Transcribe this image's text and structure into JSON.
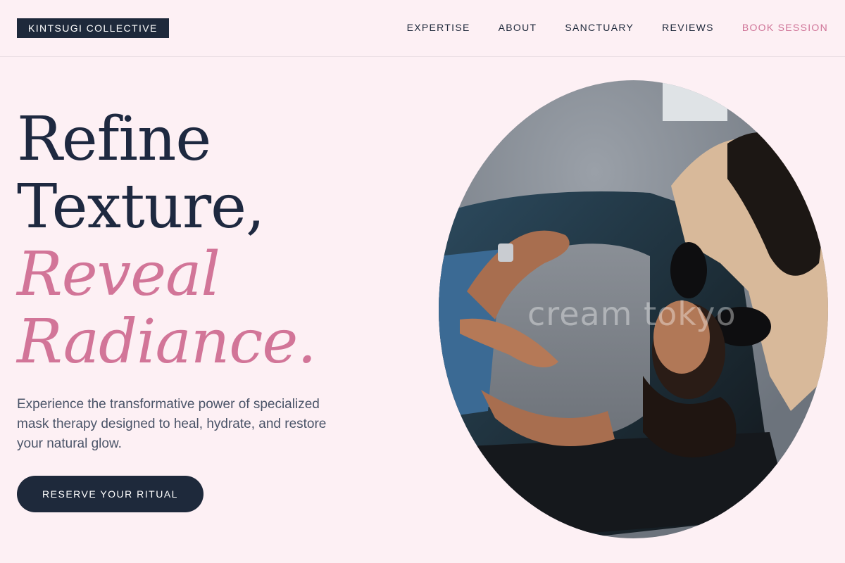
{
  "brand": {
    "name": "KINTSUGI COLLECTIVE"
  },
  "nav": {
    "items": [
      "EXPERTISE",
      "ABOUT",
      "SANCTUARY",
      "REVIEWS"
    ],
    "cta": "BOOK SESSION"
  },
  "hero": {
    "headline_line1": "Refine",
    "headline_line2": "Texture,",
    "headline_line3": "Reveal",
    "headline_line4": "Radiance.",
    "description": "Experience the transformative power of specialized mask therapy designed to heal, hydrate, and restore your natural glow.",
    "cta": "RESERVE YOUR RITUAL",
    "image_watermark": "cream tokyo"
  },
  "colors": {
    "background": "#fdf0f4",
    "primary_dark": "#1e293b",
    "accent_pink": "#d27598"
  },
  "icons": {
    "hero_image": "spa-treatment-photo"
  }
}
